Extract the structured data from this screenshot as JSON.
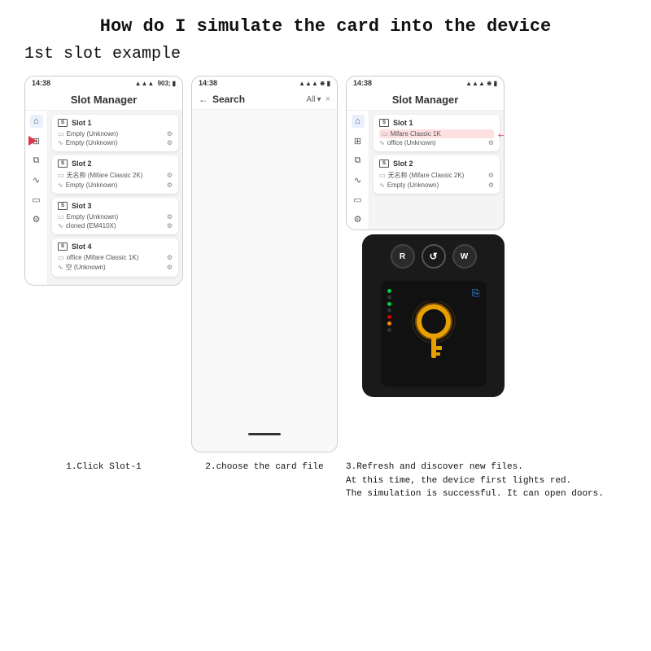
{
  "page": {
    "title": "How do I simulate the card into the device",
    "subtitle": "1st slot example"
  },
  "phone_left": {
    "status": "14:38",
    "header": "Slot Manager",
    "slots": [
      {
        "id": "slot1",
        "title": "Slot 1",
        "items": [
          {
            "icon": "card",
            "text": "Empty (Unknown)",
            "highlighted": false
          },
          {
            "icon": "wifi",
            "text": "Empty (Unknown)",
            "highlighted": false
          }
        ]
      },
      {
        "id": "slot2",
        "title": "Slot 2",
        "items": [
          {
            "icon": "card",
            "text": "无名称 (Mifare Classic 2K)",
            "highlighted": false
          },
          {
            "icon": "wifi",
            "text": "Empty (Unknown)",
            "highlighted": false
          }
        ]
      },
      {
        "id": "slot3",
        "title": "Slot 3",
        "items": [
          {
            "icon": "card",
            "text": "Empty (Unknown)",
            "highlighted": false
          },
          {
            "icon": "wifi",
            "text": "cloned (EM410X)",
            "highlighted": false
          }
        ]
      },
      {
        "id": "slot4",
        "title": "Slot 4",
        "items": [
          {
            "icon": "card",
            "text": "office (Mifare Classic 1K)",
            "highlighted": false
          },
          {
            "icon": "wifi",
            "text": "空 (Unknown)",
            "highlighted": false
          }
        ]
      }
    ]
  },
  "phone_middle": {
    "status": "14:38",
    "back_arrow": "←",
    "search_label": "Search",
    "filter": "All",
    "close": "×"
  },
  "phone_right": {
    "status": "14:38",
    "header": "Slot Manager",
    "slots": [
      {
        "id": "slot1",
        "title": "Slot 1",
        "items": [
          {
            "icon": "card",
            "text": "Mifare Classic 1K",
            "highlighted": true
          },
          {
            "icon": "wifi",
            "text": "office (Unknown)",
            "highlighted": false
          }
        ]
      },
      {
        "id": "slot2",
        "title": "Slot 2",
        "items": [
          {
            "icon": "card",
            "text": "无名称 (Mifare Classic 2K)",
            "highlighted": false
          },
          {
            "icon": "wifi",
            "text": "Empty (Unknown)",
            "highlighted": false
          }
        ]
      }
    ]
  },
  "captions": {
    "step1": "1.Click Slot-1",
    "step2": "2.choose the card file",
    "step3_line1": "3.Refresh and discover new files.",
    "step3_line2": "At this time, the device first lights red.",
    "step3_line3": "The simulation is successful. It can open doors."
  }
}
